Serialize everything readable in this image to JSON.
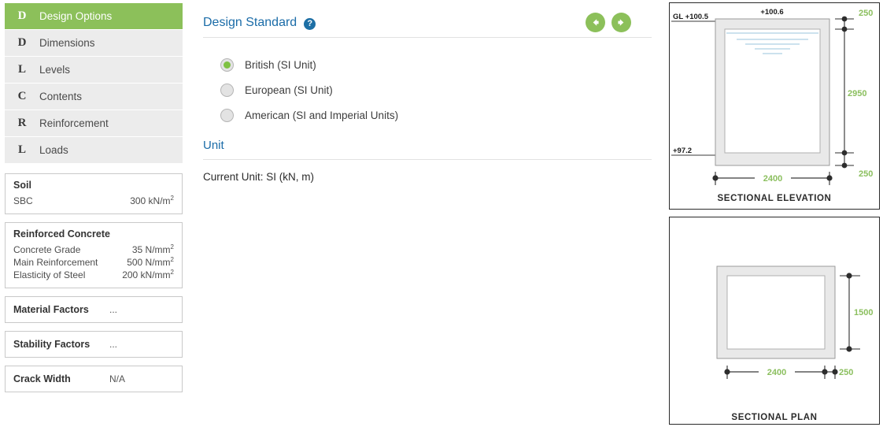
{
  "sidebar": {
    "nav_items": [
      {
        "glyph": "D",
        "label": "Design Options",
        "active": true
      },
      {
        "glyph": "D",
        "label": "Dimensions",
        "active": false
      },
      {
        "glyph": "L",
        "label": "Levels",
        "active": false
      },
      {
        "glyph": "C",
        "label": "Contents",
        "active": false
      },
      {
        "glyph": "R",
        "label": "Reinforcement",
        "active": false
      },
      {
        "glyph": "L",
        "label": "Loads",
        "active": false
      }
    ],
    "soil_panel": {
      "title": "Soil",
      "rows": [
        {
          "label": "SBC",
          "value": "300 kN/m",
          "sup": "2"
        }
      ]
    },
    "concrete_panel": {
      "title": "Reinforced Concrete",
      "rows": [
        {
          "label": "Concrete Grade",
          "value": "35 N/mm",
          "sup": "2"
        },
        {
          "label": "Main Reinforcement",
          "value": "500 N/mm",
          "sup": "2"
        },
        {
          "label": "Elasticity of Steel",
          "value": "200 kN/mm",
          "sup": "2"
        }
      ]
    },
    "compact_panels": [
      {
        "key": "Material Factors",
        "value": "..."
      },
      {
        "key": "Stability Factors",
        "value": "..."
      },
      {
        "key": "Crack Width",
        "value": "N/A"
      }
    ]
  },
  "main": {
    "section_title": "Design Standard",
    "help_glyph": "?",
    "prev_label": "Previous",
    "next_label": "Next",
    "standards": [
      {
        "label": "British (SI Unit)",
        "checked": true
      },
      {
        "label": "European (SI Unit)",
        "checked": false
      },
      {
        "label": "American (SI and Imperial Units)",
        "checked": false
      }
    ],
    "unit_section_title": "Unit",
    "current_unit": "Current Unit: SI (kN, m)"
  },
  "drawings": {
    "elevation": {
      "caption": "SECTIONAL ELEVATION",
      "level_gl": "GL +100.5",
      "level_top": "+100.6",
      "level_base": "+97.2",
      "dim_top": "250",
      "dim_height": "2950",
      "dim_bottom": "250",
      "dim_width": "2400"
    },
    "plan": {
      "caption": "SECTIONAL PLAN",
      "dim_depth": "1500",
      "dim_width": "2400",
      "dim_wall": "250"
    }
  },
  "colors": {
    "accent_green": "#8cc05a",
    "dim_green": "#8bbf5e",
    "link_blue": "#1b6ca8",
    "help_blue": "#1d6fa5",
    "concrete_fill": "#e9e9e9",
    "water_blue": "#bcd8e8"
  }
}
